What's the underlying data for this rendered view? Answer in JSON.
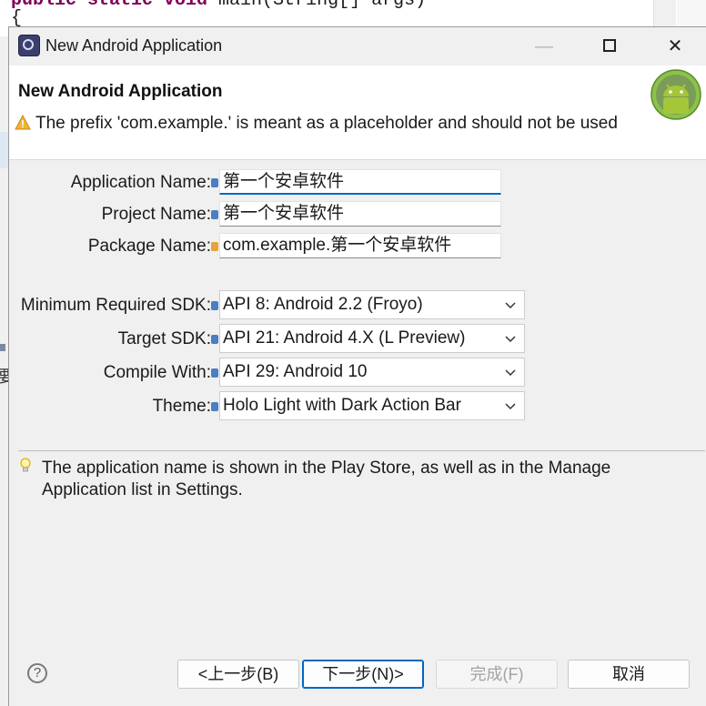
{
  "background_editor": {
    "code_line_1_keyword": "public static void",
    "code_line_1_rest": " main(String[] args)",
    "code_line_2": "{",
    "side_glyph": "要"
  },
  "titlebar": {
    "title": "New Android Application",
    "minimize_icon": "minimize-icon",
    "maximize_icon": "maximize-icon",
    "close_icon": "close-icon",
    "close_glyph": "✕"
  },
  "header": {
    "title": "New Android Application",
    "message": "The prefix 'com.example.' is meant as a placeholder and should not be used"
  },
  "form": {
    "application_name": {
      "label": "Application Name:",
      "value": "第一个安卓软件"
    },
    "project_name": {
      "label": "Project Name:",
      "value": "第一个安卓软件"
    },
    "package_name": {
      "label": "Package Name:",
      "value": "com.example.第一个安卓软件"
    },
    "min_sdk": {
      "label": "Minimum Required SDK:",
      "value": "API 8: Android 2.2 (Froyo)"
    },
    "target_sdk": {
      "label": "Target SDK:",
      "value": "API 21: Android 4.X (L Preview)"
    },
    "compile_with": {
      "label": "Compile With:",
      "value": "API 29: Android 10"
    },
    "theme": {
      "label": "Theme:",
      "value": "Holo Light with Dark Action Bar"
    }
  },
  "help": {
    "text": "The application name is shown in the Play Store, as well as in the Manage Application list in Settings."
  },
  "buttons": {
    "help_glyph": "?",
    "back": "<上一步(B)",
    "next": "下一步(N)>",
    "finish": "完成(F)",
    "cancel": "取消"
  },
  "colors": {
    "accent": "#0067c0",
    "info_marker": "#4a7fc2",
    "warning": "#e6a23c",
    "android_green": "#8bc34a"
  }
}
